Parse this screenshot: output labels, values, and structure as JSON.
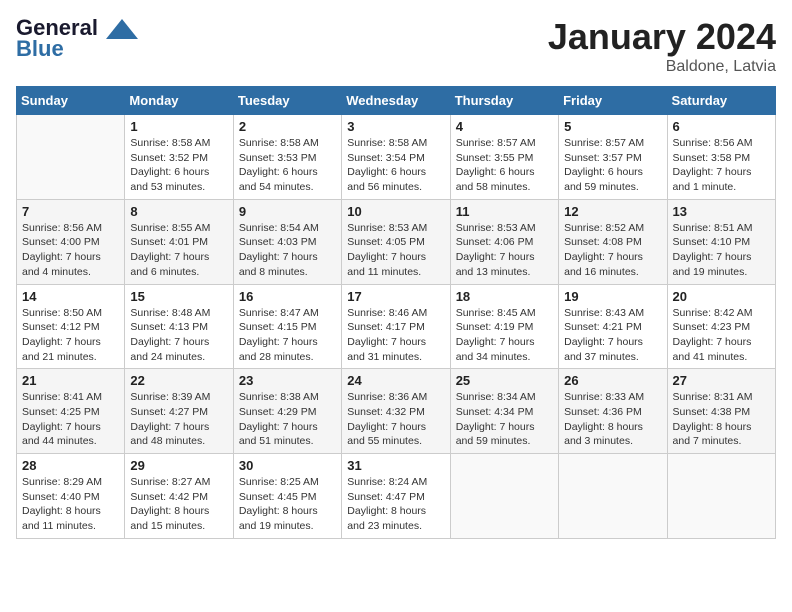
{
  "header": {
    "logo_general": "General",
    "logo_blue": "Blue",
    "month_title": "January 2024",
    "location": "Baldone, Latvia"
  },
  "weekdays": [
    "Sunday",
    "Monday",
    "Tuesday",
    "Wednesday",
    "Thursday",
    "Friday",
    "Saturday"
  ],
  "weeks": [
    [
      {
        "day": "",
        "info": ""
      },
      {
        "day": "1",
        "info": "Sunrise: 8:58 AM\nSunset: 3:52 PM\nDaylight: 6 hours\nand 53 minutes."
      },
      {
        "day": "2",
        "info": "Sunrise: 8:58 AM\nSunset: 3:53 PM\nDaylight: 6 hours\nand 54 minutes."
      },
      {
        "day": "3",
        "info": "Sunrise: 8:58 AM\nSunset: 3:54 PM\nDaylight: 6 hours\nand 56 minutes."
      },
      {
        "day": "4",
        "info": "Sunrise: 8:57 AM\nSunset: 3:55 PM\nDaylight: 6 hours\nand 58 minutes."
      },
      {
        "day": "5",
        "info": "Sunrise: 8:57 AM\nSunset: 3:57 PM\nDaylight: 6 hours\nand 59 minutes."
      },
      {
        "day": "6",
        "info": "Sunrise: 8:56 AM\nSunset: 3:58 PM\nDaylight: 7 hours\nand 1 minute."
      }
    ],
    [
      {
        "day": "7",
        "info": "Sunrise: 8:56 AM\nSunset: 4:00 PM\nDaylight: 7 hours\nand 4 minutes."
      },
      {
        "day": "8",
        "info": "Sunrise: 8:55 AM\nSunset: 4:01 PM\nDaylight: 7 hours\nand 6 minutes."
      },
      {
        "day": "9",
        "info": "Sunrise: 8:54 AM\nSunset: 4:03 PM\nDaylight: 7 hours\nand 8 minutes."
      },
      {
        "day": "10",
        "info": "Sunrise: 8:53 AM\nSunset: 4:05 PM\nDaylight: 7 hours\nand 11 minutes."
      },
      {
        "day": "11",
        "info": "Sunrise: 8:53 AM\nSunset: 4:06 PM\nDaylight: 7 hours\nand 13 minutes."
      },
      {
        "day": "12",
        "info": "Sunrise: 8:52 AM\nSunset: 4:08 PM\nDaylight: 7 hours\nand 16 minutes."
      },
      {
        "day": "13",
        "info": "Sunrise: 8:51 AM\nSunset: 4:10 PM\nDaylight: 7 hours\nand 19 minutes."
      }
    ],
    [
      {
        "day": "14",
        "info": "Sunrise: 8:50 AM\nSunset: 4:12 PM\nDaylight: 7 hours\nand 21 minutes."
      },
      {
        "day": "15",
        "info": "Sunrise: 8:48 AM\nSunset: 4:13 PM\nDaylight: 7 hours\nand 24 minutes."
      },
      {
        "day": "16",
        "info": "Sunrise: 8:47 AM\nSunset: 4:15 PM\nDaylight: 7 hours\nand 28 minutes."
      },
      {
        "day": "17",
        "info": "Sunrise: 8:46 AM\nSunset: 4:17 PM\nDaylight: 7 hours\nand 31 minutes."
      },
      {
        "day": "18",
        "info": "Sunrise: 8:45 AM\nSunset: 4:19 PM\nDaylight: 7 hours\nand 34 minutes."
      },
      {
        "day": "19",
        "info": "Sunrise: 8:43 AM\nSunset: 4:21 PM\nDaylight: 7 hours\nand 37 minutes."
      },
      {
        "day": "20",
        "info": "Sunrise: 8:42 AM\nSunset: 4:23 PM\nDaylight: 7 hours\nand 41 minutes."
      }
    ],
    [
      {
        "day": "21",
        "info": "Sunrise: 8:41 AM\nSunset: 4:25 PM\nDaylight: 7 hours\nand 44 minutes."
      },
      {
        "day": "22",
        "info": "Sunrise: 8:39 AM\nSunset: 4:27 PM\nDaylight: 7 hours\nand 48 minutes."
      },
      {
        "day": "23",
        "info": "Sunrise: 8:38 AM\nSunset: 4:29 PM\nDaylight: 7 hours\nand 51 minutes."
      },
      {
        "day": "24",
        "info": "Sunrise: 8:36 AM\nSunset: 4:32 PM\nDaylight: 7 hours\nand 55 minutes."
      },
      {
        "day": "25",
        "info": "Sunrise: 8:34 AM\nSunset: 4:34 PM\nDaylight: 7 hours\nand 59 minutes."
      },
      {
        "day": "26",
        "info": "Sunrise: 8:33 AM\nSunset: 4:36 PM\nDaylight: 8 hours\nand 3 minutes."
      },
      {
        "day": "27",
        "info": "Sunrise: 8:31 AM\nSunset: 4:38 PM\nDaylight: 8 hours\nand 7 minutes."
      }
    ],
    [
      {
        "day": "28",
        "info": "Sunrise: 8:29 AM\nSunset: 4:40 PM\nDaylight: 8 hours\nand 11 minutes."
      },
      {
        "day": "29",
        "info": "Sunrise: 8:27 AM\nSunset: 4:42 PM\nDaylight: 8 hours\nand 15 minutes."
      },
      {
        "day": "30",
        "info": "Sunrise: 8:25 AM\nSunset: 4:45 PM\nDaylight: 8 hours\nand 19 minutes."
      },
      {
        "day": "31",
        "info": "Sunrise: 8:24 AM\nSunset: 4:47 PM\nDaylight: 8 hours\nand 23 minutes."
      },
      {
        "day": "",
        "info": ""
      },
      {
        "day": "",
        "info": ""
      },
      {
        "day": "",
        "info": ""
      }
    ]
  ]
}
